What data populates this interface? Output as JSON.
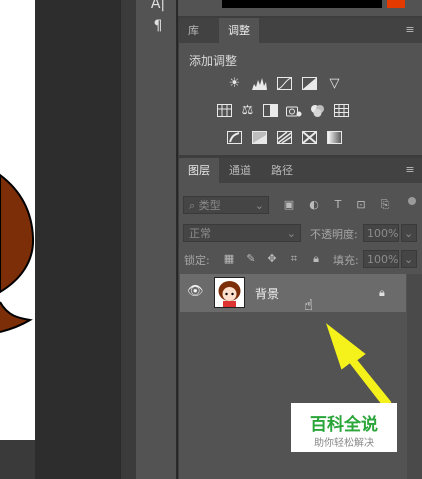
{
  "adjust_panel": {
    "tabs": [
      {
        "label": "库"
      },
      {
        "label": "调整"
      }
    ],
    "title": "添加调整"
  },
  "layers_panel": {
    "tabs": [
      {
        "label": "图层"
      },
      {
        "label": "通道"
      },
      {
        "label": "路径"
      }
    ],
    "filter_placeholder": "类型",
    "blend_mode": "正常",
    "opacity_label": "不透明度:",
    "opacity_value": "100%",
    "lock_label": "锁定:",
    "fill_label": "填充:",
    "fill_value": "100%",
    "layers": [
      {
        "name": "背景",
        "visible": true,
        "locked": true
      }
    ]
  },
  "watermark": {
    "title": "百科全说",
    "subtitle": "助你轻松解决"
  },
  "colors": {
    "accent_foreground": "#e33a00",
    "arrow": "#f4f21a",
    "watermark_green": "#2aa53a"
  },
  "icons": {
    "adjustments_row1": [
      "brightness-icon",
      "levels-icon",
      "curves-icon",
      "exposure-icon",
      "vibrance-icon"
    ],
    "adjustments_row2": [
      "hue-saturation-icon",
      "color-balance-icon",
      "black-white-icon",
      "photo-filter-icon",
      "channel-mixer-icon",
      "color-lookup-icon"
    ],
    "adjustments_row3": [
      "invert-icon",
      "posterize-icon",
      "threshold-icon",
      "selective-color-icon",
      "gradient-map-icon"
    ]
  }
}
